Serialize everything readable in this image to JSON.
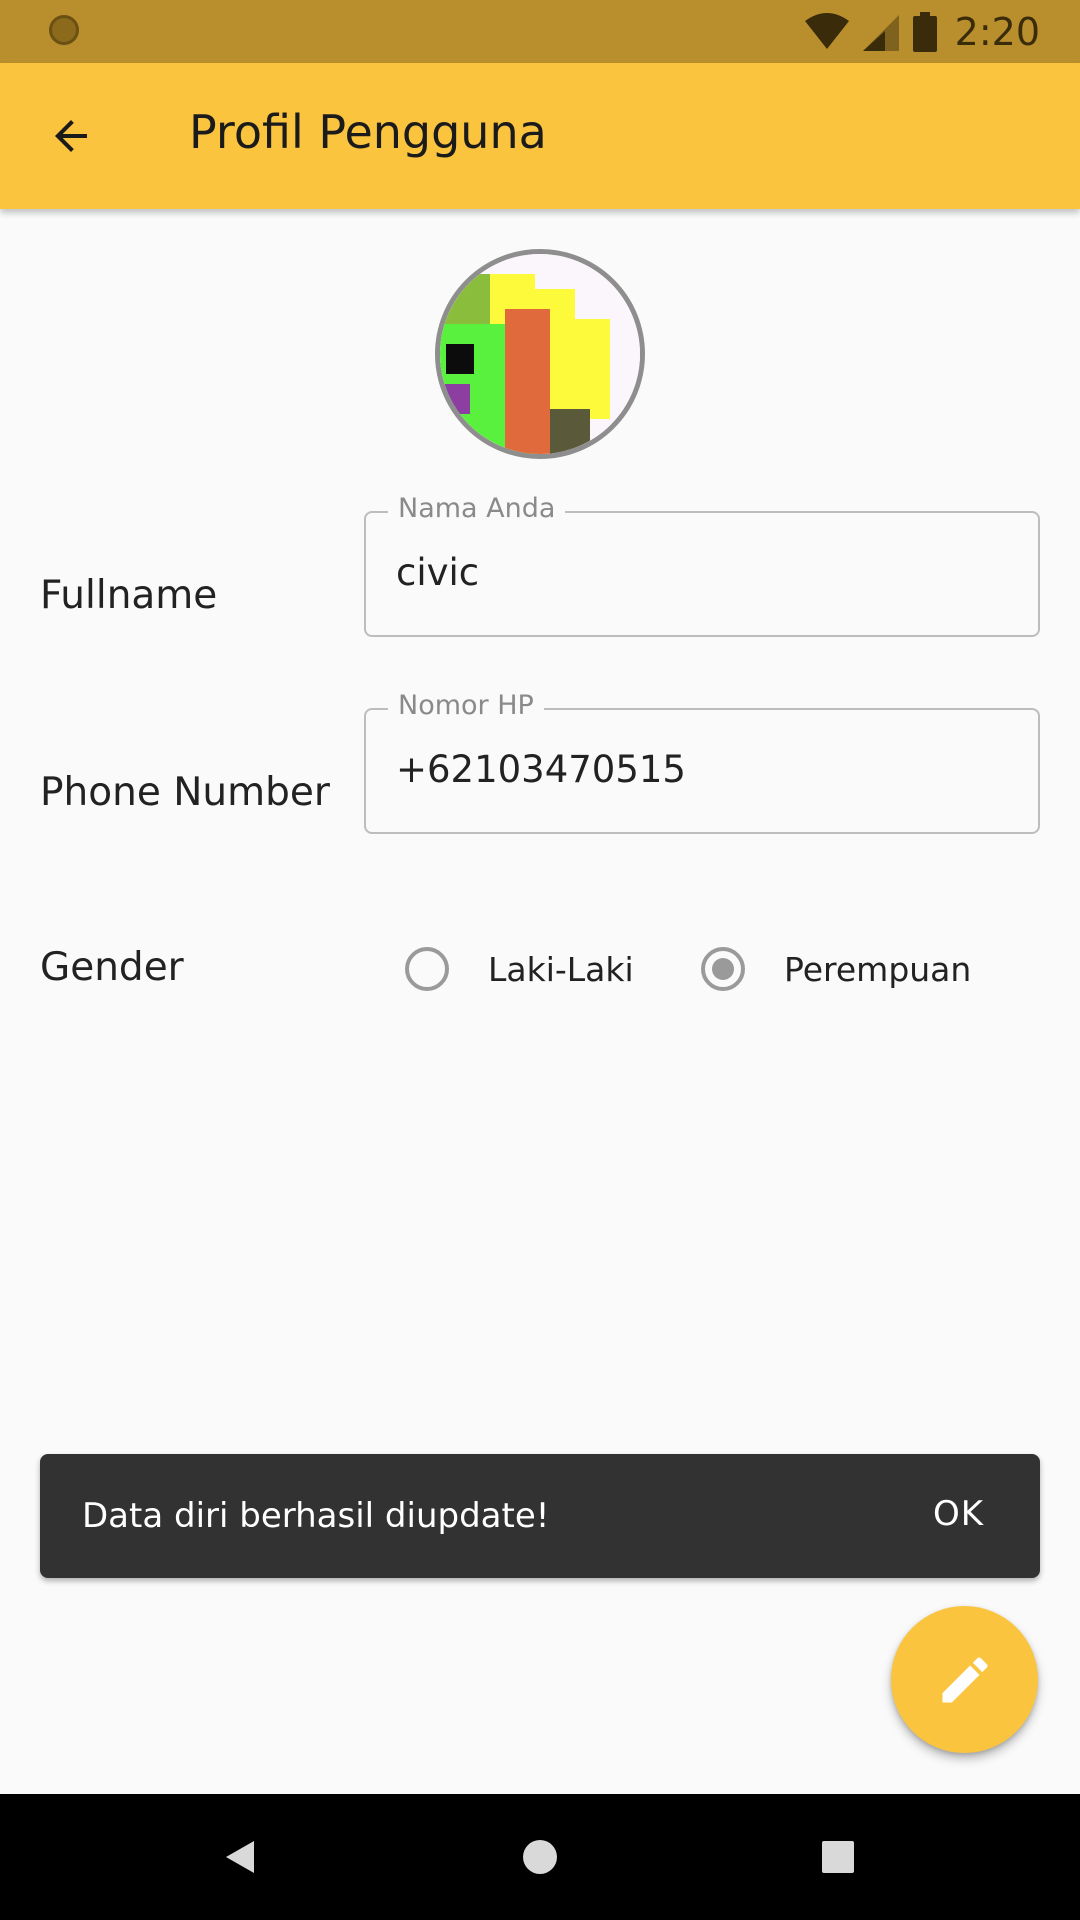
{
  "status_bar": {
    "time": "2:20",
    "icons": [
      "circle-icon",
      "wifi-icon",
      "signal-icon",
      "battery-icon"
    ]
  },
  "app_bar": {
    "title": "Profil Pengguna",
    "back_icon": "arrow-back-icon",
    "color": "#fbc43f"
  },
  "profile": {
    "fields": [
      {
        "label": "Fullname",
        "field_label": "Nama Anda",
        "value": "civic"
      },
      {
        "label": "Phone Number",
        "field_label": "Nomor HP",
        "value": "+62103470515"
      }
    ],
    "gender": {
      "label": "Gender",
      "options": [
        {
          "label": "Laki-Laki",
          "selected": false
        },
        {
          "label": "Perempuan",
          "selected": true
        }
      ]
    }
  },
  "snackbar": {
    "message": "Data diri berhasil diupdate!",
    "action": "OK"
  },
  "fab": {
    "icon": "pencil-icon"
  },
  "nav_bar": {
    "icons": [
      "back-triangle-icon",
      "home-circle-icon",
      "recents-square-icon"
    ]
  }
}
